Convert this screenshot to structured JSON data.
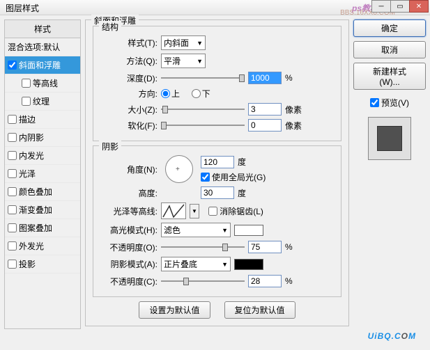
{
  "title": "图层样式",
  "watermark1": "ps教程论坛",
  "watermark2": "BBS.16XX8.COM",
  "sidebar": {
    "header": "样式",
    "blend": "混合选项:默认",
    "bevel": "斜面和浮雕",
    "contour": "等高线",
    "texture": "纹理",
    "stroke": "描边",
    "innerShadow": "内阴影",
    "innerGlow": "内发光",
    "satin": "光泽",
    "colorOverlay": "颜色叠加",
    "gradientOverlay": "渐变叠加",
    "patternOverlay": "图案叠加",
    "outerGlow": "外发光",
    "dropShadow": "投影"
  },
  "bevel": {
    "groupTitle": "斜面和浮雕",
    "struct": "结构",
    "styleLabel": "样式(T):",
    "styleValue": "内斜面",
    "techLabel": "方法(Q):",
    "techValue": "平滑",
    "depthLabel": "深度(D):",
    "depthValue": "1000",
    "pct": "%",
    "dirLabel": "方向:",
    "dirUp": "上",
    "dirDown": "下",
    "sizeLabel": "大小(Z):",
    "sizeValue": "3",
    "px": "像素",
    "softenLabel": "软化(F):",
    "softenValue": "0",
    "shade": "阴影",
    "angleLabel": "角度(N):",
    "angleValue": "120",
    "deg": "度",
    "globalLabel": "使用全局光(G)",
    "altLabel": "高度:",
    "altValue": "30",
    "glossLabel": "光泽等高线:",
    "aaLabel": "消除锯齿(L)",
    "hlModeLabel": "高光模式(H):",
    "hlModeValue": "滤色",
    "hlColor": "#ffffff",
    "hlOpLabel": "不透明度(O):",
    "hlOpValue": "75",
    "shModeLabel": "阴影模式(A):",
    "shModeValue": "正片叠底",
    "shColor": "#000000",
    "shOpLabel": "不透明度(C):",
    "shOpValue": "28",
    "btnDefault": "设置为默认值",
    "btnReset": "复位为默认值"
  },
  "right": {
    "ok": "确定",
    "cancel": "取消",
    "newStyle": "新建样式(W)...",
    "preview": "预览(V)"
  },
  "logo": {
    "u": "U",
    "i": "i",
    "b": "B",
    "q": "Q",
    "dot": ".",
    "c": "C",
    "o": "O",
    "m": "M"
  }
}
